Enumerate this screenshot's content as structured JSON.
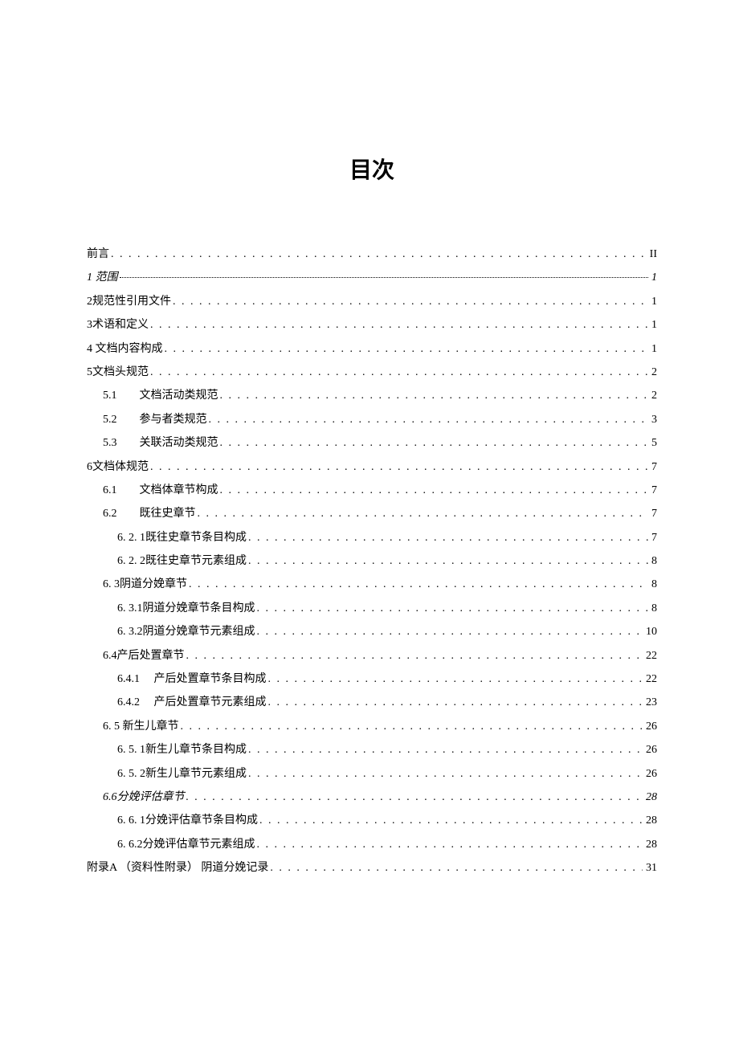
{
  "title": "目次",
  "entries": [
    {
      "label": "前言",
      "page": "II",
      "level": 0,
      "numbered": false
    },
    {
      "label": "1 范围",
      "page": "1",
      "level": 0,
      "numbered": false,
      "italic": true,
      "thinDots": true
    },
    {
      "label": "2规范性引用文件",
      "page": "1",
      "level": 0,
      "numbered": false
    },
    {
      "label": "3术语和定义",
      "page": "1",
      "level": 0,
      "numbered": false
    },
    {
      "label": "4 文档内容构成",
      "page": "1",
      "level": 0,
      "numbered": false
    },
    {
      "label": "5文档头规范",
      "page": "2",
      "level": 0,
      "numbered": false
    },
    {
      "num": "5.1",
      "label": "文档活动类规范",
      "page": "2",
      "level": 1,
      "numbered": true
    },
    {
      "num": "5.2",
      "label": "参与者类规范",
      "page": "3",
      "level": 1,
      "numbered": true
    },
    {
      "num": "5.3",
      "label": "关联活动类规范",
      "page": "5",
      "level": 1,
      "numbered": true
    },
    {
      "label": "6文档体规范",
      "page": "7",
      "level": 0,
      "numbered": false
    },
    {
      "num": "6.1",
      "label": "文档体章节构成",
      "page": "7",
      "level": 1,
      "numbered": true
    },
    {
      "num": "6.2",
      "label": "既往史章节",
      "page": "7",
      "level": 1,
      "numbered": true
    },
    {
      "label": "6. 2. 1既往史章节条目构成",
      "page": " 7",
      "level": 2,
      "numbered": false
    },
    {
      "label": "6. 2. 2既往史章节元素组成",
      "page": "8",
      "level": 2,
      "numbered": false
    },
    {
      "label": "6. 3阴道分娩章节",
      "page": "8",
      "level": 1,
      "numbered": false
    },
    {
      "label": "6. 3.1阴道分娩章节条目构成",
      "page": "8",
      "level": 2,
      "numbered": false
    },
    {
      "label": "6. 3.2阴道分娩章节元素组成",
      "page": " 10",
      "level": 2,
      "numbered": false
    },
    {
      "label": "6.4产后处置章节",
      "page": "22",
      "level": 1,
      "numbered": false
    },
    {
      "num": "6.4.1",
      "label": "产后处置章节条目构成",
      "page": " 22",
      "level": 3,
      "numbered": true
    },
    {
      "num": "6.4.2",
      "label": "产后处置章节元素组成",
      "page": "23",
      "level": 3,
      "numbered": true
    },
    {
      "label": "6. 5 新生儿章节",
      "page": "26",
      "level": 1,
      "numbered": false
    },
    {
      "label": "6. 5. 1新生儿章节条目构成",
      "page": " 26",
      "level": 2,
      "numbered": false
    },
    {
      "label": "6. 5. 2新生儿章节元素组成",
      "page": "26",
      "level": 2,
      "numbered": false
    },
    {
      "label": "6.6分娩评估章节",
      "page": "28",
      "level": 1,
      "numbered": false,
      "italic": true
    },
    {
      "label": "6. 6. 1分娩评估章节条目构成",
      "page": " 28",
      "level": 2,
      "numbered": false
    },
    {
      "label": "6. 6.2分娩评估章节元素组成",
      "page": "28",
      "level": 2,
      "numbered": false
    },
    {
      "label": "附录A （资料性附录）  阴道分娩记录",
      "page": "31",
      "level": 0,
      "numbered": false
    }
  ]
}
